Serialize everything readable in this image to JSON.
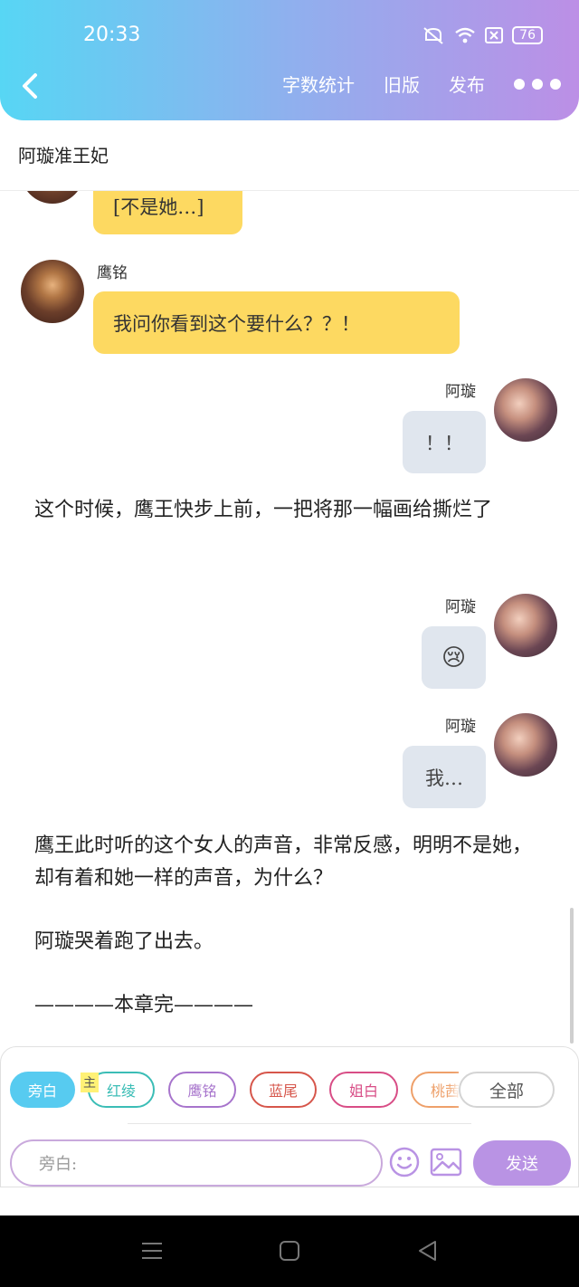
{
  "status_bar": {
    "time": "20:33",
    "battery": "76"
  },
  "toolbar": {
    "word_count": "字数统计",
    "old_version": "旧版",
    "publish": "发布"
  },
  "doc_title": "阿璇准王妃",
  "messages": [
    {
      "speaker": "",
      "text": "[不是她…]"
    },
    {
      "speaker": "鹰铭",
      "text": "我问你看到这个要什么？？！"
    },
    {
      "speaker": "阿璇",
      "text": "！！"
    },
    {
      "narration": "这个时候，鹰王快步上前，一把将那一幅画给撕烂了"
    },
    {
      "speaker": "阿璇",
      "text": "😢"
    },
    {
      "speaker": "阿璇",
      "text": "我…"
    },
    {
      "narration": "鹰王此时听的这个女人的声音，非常反感，明明不是她，却有着和她一样的声音，为什么？"
    },
    {
      "narration": "阿璇哭着跑了出去。"
    },
    {
      "narration": "————本章完————"
    }
  ],
  "characters": [
    {
      "label": "旁白",
      "color": "#57cbf0"
    },
    {
      "label": "红绫",
      "color": "#3bbdb6"
    },
    {
      "label": "鹰铭",
      "color": "#a774cc"
    },
    {
      "label": "蓝尾",
      "color": "#d6564b"
    },
    {
      "label": "姐白",
      "color": "#d84d86"
    },
    {
      "label": "桃茜",
      "color": "#eea06a"
    }
  ],
  "main_tag": "主",
  "all_button": "全部",
  "input": {
    "placeholder": "旁白:"
  },
  "send_label": "发送"
}
